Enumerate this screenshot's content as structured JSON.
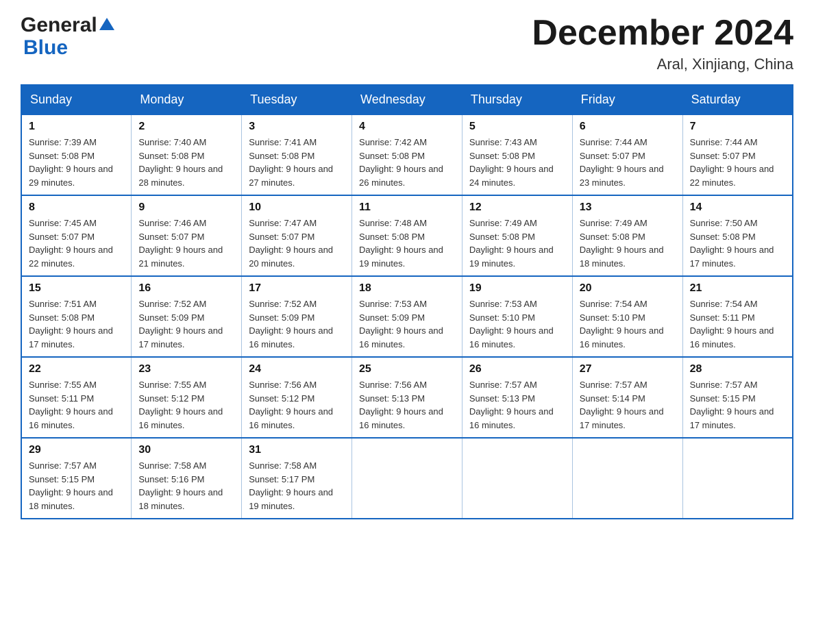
{
  "header": {
    "logo_general": "General",
    "logo_blue": "Blue",
    "month_title": "December 2024",
    "location": "Aral, Xinjiang, China"
  },
  "days_of_week": [
    "Sunday",
    "Monday",
    "Tuesday",
    "Wednesday",
    "Thursday",
    "Friday",
    "Saturday"
  ],
  "weeks": [
    [
      {
        "day": "1",
        "sunrise": "7:39 AM",
        "sunset": "5:08 PM",
        "daylight": "9 hours and 29 minutes."
      },
      {
        "day": "2",
        "sunrise": "7:40 AM",
        "sunset": "5:08 PM",
        "daylight": "9 hours and 28 minutes."
      },
      {
        "day": "3",
        "sunrise": "7:41 AM",
        "sunset": "5:08 PM",
        "daylight": "9 hours and 27 minutes."
      },
      {
        "day": "4",
        "sunrise": "7:42 AM",
        "sunset": "5:08 PM",
        "daylight": "9 hours and 26 minutes."
      },
      {
        "day": "5",
        "sunrise": "7:43 AM",
        "sunset": "5:08 PM",
        "daylight": "9 hours and 24 minutes."
      },
      {
        "day": "6",
        "sunrise": "7:44 AM",
        "sunset": "5:07 PM",
        "daylight": "9 hours and 23 minutes."
      },
      {
        "day": "7",
        "sunrise": "7:44 AM",
        "sunset": "5:07 PM",
        "daylight": "9 hours and 22 minutes."
      }
    ],
    [
      {
        "day": "8",
        "sunrise": "7:45 AM",
        "sunset": "5:07 PM",
        "daylight": "9 hours and 22 minutes."
      },
      {
        "day": "9",
        "sunrise": "7:46 AM",
        "sunset": "5:07 PM",
        "daylight": "9 hours and 21 minutes."
      },
      {
        "day": "10",
        "sunrise": "7:47 AM",
        "sunset": "5:07 PM",
        "daylight": "9 hours and 20 minutes."
      },
      {
        "day": "11",
        "sunrise": "7:48 AM",
        "sunset": "5:08 PM",
        "daylight": "9 hours and 19 minutes."
      },
      {
        "day": "12",
        "sunrise": "7:49 AM",
        "sunset": "5:08 PM",
        "daylight": "9 hours and 19 minutes."
      },
      {
        "day": "13",
        "sunrise": "7:49 AM",
        "sunset": "5:08 PM",
        "daylight": "9 hours and 18 minutes."
      },
      {
        "day": "14",
        "sunrise": "7:50 AM",
        "sunset": "5:08 PM",
        "daylight": "9 hours and 17 minutes."
      }
    ],
    [
      {
        "day": "15",
        "sunrise": "7:51 AM",
        "sunset": "5:08 PM",
        "daylight": "9 hours and 17 minutes."
      },
      {
        "day": "16",
        "sunrise": "7:52 AM",
        "sunset": "5:09 PM",
        "daylight": "9 hours and 17 minutes."
      },
      {
        "day": "17",
        "sunrise": "7:52 AM",
        "sunset": "5:09 PM",
        "daylight": "9 hours and 16 minutes."
      },
      {
        "day": "18",
        "sunrise": "7:53 AM",
        "sunset": "5:09 PM",
        "daylight": "9 hours and 16 minutes."
      },
      {
        "day": "19",
        "sunrise": "7:53 AM",
        "sunset": "5:10 PM",
        "daylight": "9 hours and 16 minutes."
      },
      {
        "day": "20",
        "sunrise": "7:54 AM",
        "sunset": "5:10 PM",
        "daylight": "9 hours and 16 minutes."
      },
      {
        "day": "21",
        "sunrise": "7:54 AM",
        "sunset": "5:11 PM",
        "daylight": "9 hours and 16 minutes."
      }
    ],
    [
      {
        "day": "22",
        "sunrise": "7:55 AM",
        "sunset": "5:11 PM",
        "daylight": "9 hours and 16 minutes."
      },
      {
        "day": "23",
        "sunrise": "7:55 AM",
        "sunset": "5:12 PM",
        "daylight": "9 hours and 16 minutes."
      },
      {
        "day": "24",
        "sunrise": "7:56 AM",
        "sunset": "5:12 PM",
        "daylight": "9 hours and 16 minutes."
      },
      {
        "day": "25",
        "sunrise": "7:56 AM",
        "sunset": "5:13 PM",
        "daylight": "9 hours and 16 minutes."
      },
      {
        "day": "26",
        "sunrise": "7:57 AM",
        "sunset": "5:13 PM",
        "daylight": "9 hours and 16 minutes."
      },
      {
        "day": "27",
        "sunrise": "7:57 AM",
        "sunset": "5:14 PM",
        "daylight": "9 hours and 17 minutes."
      },
      {
        "day": "28",
        "sunrise": "7:57 AM",
        "sunset": "5:15 PM",
        "daylight": "9 hours and 17 minutes."
      }
    ],
    [
      {
        "day": "29",
        "sunrise": "7:57 AM",
        "sunset": "5:15 PM",
        "daylight": "9 hours and 18 minutes."
      },
      {
        "day": "30",
        "sunrise": "7:58 AM",
        "sunset": "5:16 PM",
        "daylight": "9 hours and 18 minutes."
      },
      {
        "day": "31",
        "sunrise": "7:58 AM",
        "sunset": "5:17 PM",
        "daylight": "9 hours and 19 minutes."
      },
      null,
      null,
      null,
      null
    ]
  ]
}
